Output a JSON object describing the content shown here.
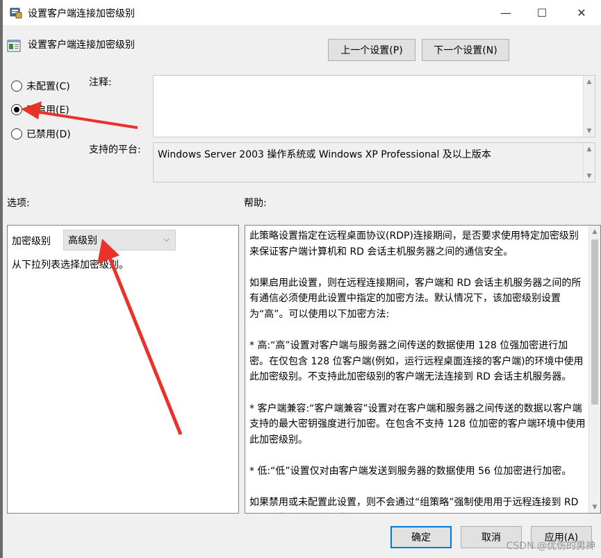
{
  "window": {
    "title": "设置客户端连接加密级别",
    "minimize_glyph": "—",
    "maximize_glyph": "☐",
    "close_glyph": "✕"
  },
  "header": {
    "title": "设置客户端连接加密级别",
    "prev_button": "上一个设置(P)",
    "next_button": "下一个设置(N)"
  },
  "state": {
    "options": [
      {
        "label": "未配置(C)",
        "checked": false
      },
      {
        "label": "已启用(E)",
        "checked": true
      },
      {
        "label": "已禁用(D)",
        "checked": false
      }
    ]
  },
  "comment": {
    "label": "注释:",
    "value": ""
  },
  "platform": {
    "label": "支持的平台:",
    "value": "Windows Server 2003 操作系统或 Windows XP Professional 及以上版本"
  },
  "sections": {
    "options_label": "选项:",
    "help_label": "帮助:"
  },
  "options_panel": {
    "level_label": "加密级别",
    "level_value": "高级别",
    "hint": "从下拉列表选择加密级别。"
  },
  "help": {
    "paragraphs": [
      "此策略设置指定在远程桌面协议(RDP)连接期间，是否要求使用特定加密级别来保证客户端计算机和 RD 会话主机服务器之间的通信安全。",
      "如果启用此设置，则在远程连接期间，客户端和 RD 会话主机服务器之间的所有通信必须使用此设置中指定的加密方法。默认情况下，该加密级别设置为“高”。可以使用以下加密方法:",
      "* 高:“高”设置对客户端与服务器之间传送的数据使用 128 位强加密进行加密。在仅包含 128 位客户端(例如，运行远程桌面连接的客户端)的环境中使用此加密级别。不支持此加密级别的客户端无法连接到 RD 会话主机服务器。",
      "* 客户端兼容:“客户端兼容”设置对在客户端和服务器之间传送的数据以客户端支持的最大密钥强度进行加密。在包含不支持 128 位加密的客户端环境中使用此加密级别。",
      "* 低:“低”设置仅对由客户端发送到服务器的数据使用 56 位加密进行加密。",
      "如果禁用或未配置此设置，则不会通过“组策略”强制使用用于远程连接到 RD 会话主机服务器的加密级别。"
    ]
  },
  "footer": {
    "ok_button": "确定",
    "cancel_button": "取消",
    "apply_button": "应用(A)"
  },
  "watermark": "CSDN @优伤的男神",
  "colors": {
    "annotation_arrow": "#e8322a",
    "focus_border": "#0078d7"
  }
}
